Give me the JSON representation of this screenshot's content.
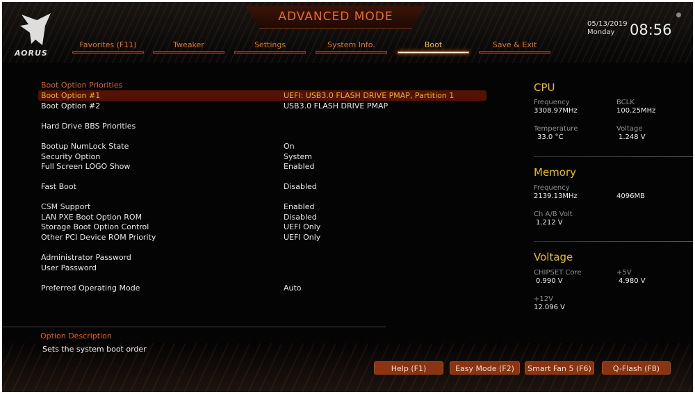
{
  "header": {
    "title": "ADVANCED MODE",
    "logo": "AORUS",
    "date": "05/13/2019",
    "day": "Monday",
    "time": "08:56"
  },
  "tabs": [
    {
      "label": "Favorites (F11)"
    },
    {
      "label": "Tweaker"
    },
    {
      "label": "Settings"
    },
    {
      "label": "System Info."
    },
    {
      "label": "Boot",
      "active": true
    },
    {
      "label": "Save & Exit"
    }
  ],
  "menu": {
    "heading": "Boot Option Priorities",
    "items": [
      {
        "label": "Boot Option #1",
        "value": "UEFI: USB3.0 FLASH DRIVE PMAP, Partition 1",
        "selected": true
      },
      {
        "label": "Boot Option #2",
        "value": "USB3.0 FLASH DRIVE PMAP"
      },
      {
        "label": "Hard Drive BBS Priorities",
        "value": ""
      },
      {
        "label": "Bootup NumLock State",
        "value": "On"
      },
      {
        "label": "Security Option",
        "value": "System"
      },
      {
        "label": "Full Screen LOGO Show",
        "value": "Enabled"
      },
      {
        "label": "Fast Boot",
        "value": "Disabled"
      },
      {
        "label": "CSM Support",
        "value": "Enabled"
      },
      {
        "label": "LAN PXE Boot Option ROM",
        "value": "Disabled"
      },
      {
        "label": "Storage Boot Option Control",
        "value": "UEFI Only"
      },
      {
        "label": "Other PCI Device ROM Priority",
        "value": "UEFI Only"
      },
      {
        "label": "Administrator Password",
        "value": ""
      },
      {
        "label": "User Password",
        "value": ""
      },
      {
        "label": "Preferred Operating Mode",
        "value": "Auto"
      }
    ]
  },
  "description": {
    "heading": "Option Description",
    "text": "Sets the system boot order"
  },
  "monitor": {
    "cpu": {
      "title": "CPU",
      "freq_label": "Frequency",
      "freq": "3308.97MHz",
      "bclk_label": "BCLK",
      "bclk": "100.25MHz",
      "temp_label": "Temperature",
      "temp": "33.0 °C",
      "volt_label": "Voltage",
      "volt": "1.248 V"
    },
    "memory": {
      "title": "Memory",
      "freq_label": "Frequency",
      "freq": "2139.13MHz",
      "size": "4096MB",
      "volt_label": "Ch A/B Volt",
      "volt": "1.212 V"
    },
    "voltage": {
      "title": "Voltage",
      "chipset_label": "CHIPSET Core",
      "chipset": "0.990 V",
      "v5_label": "+5V",
      "v5": "4.980 V",
      "v12_label": "+12V",
      "v12": "12.096 V"
    }
  },
  "buttons": [
    {
      "label": "Help (F1)"
    },
    {
      "label": "Easy Mode (F2)"
    },
    {
      "label": "Smart Fan 5 (F6)"
    },
    {
      "label": "Q-Flash (F8)"
    }
  ],
  "colors": {
    "accent": "#e0621a",
    "highlight": "#541204",
    "section": "#e8c010"
  }
}
